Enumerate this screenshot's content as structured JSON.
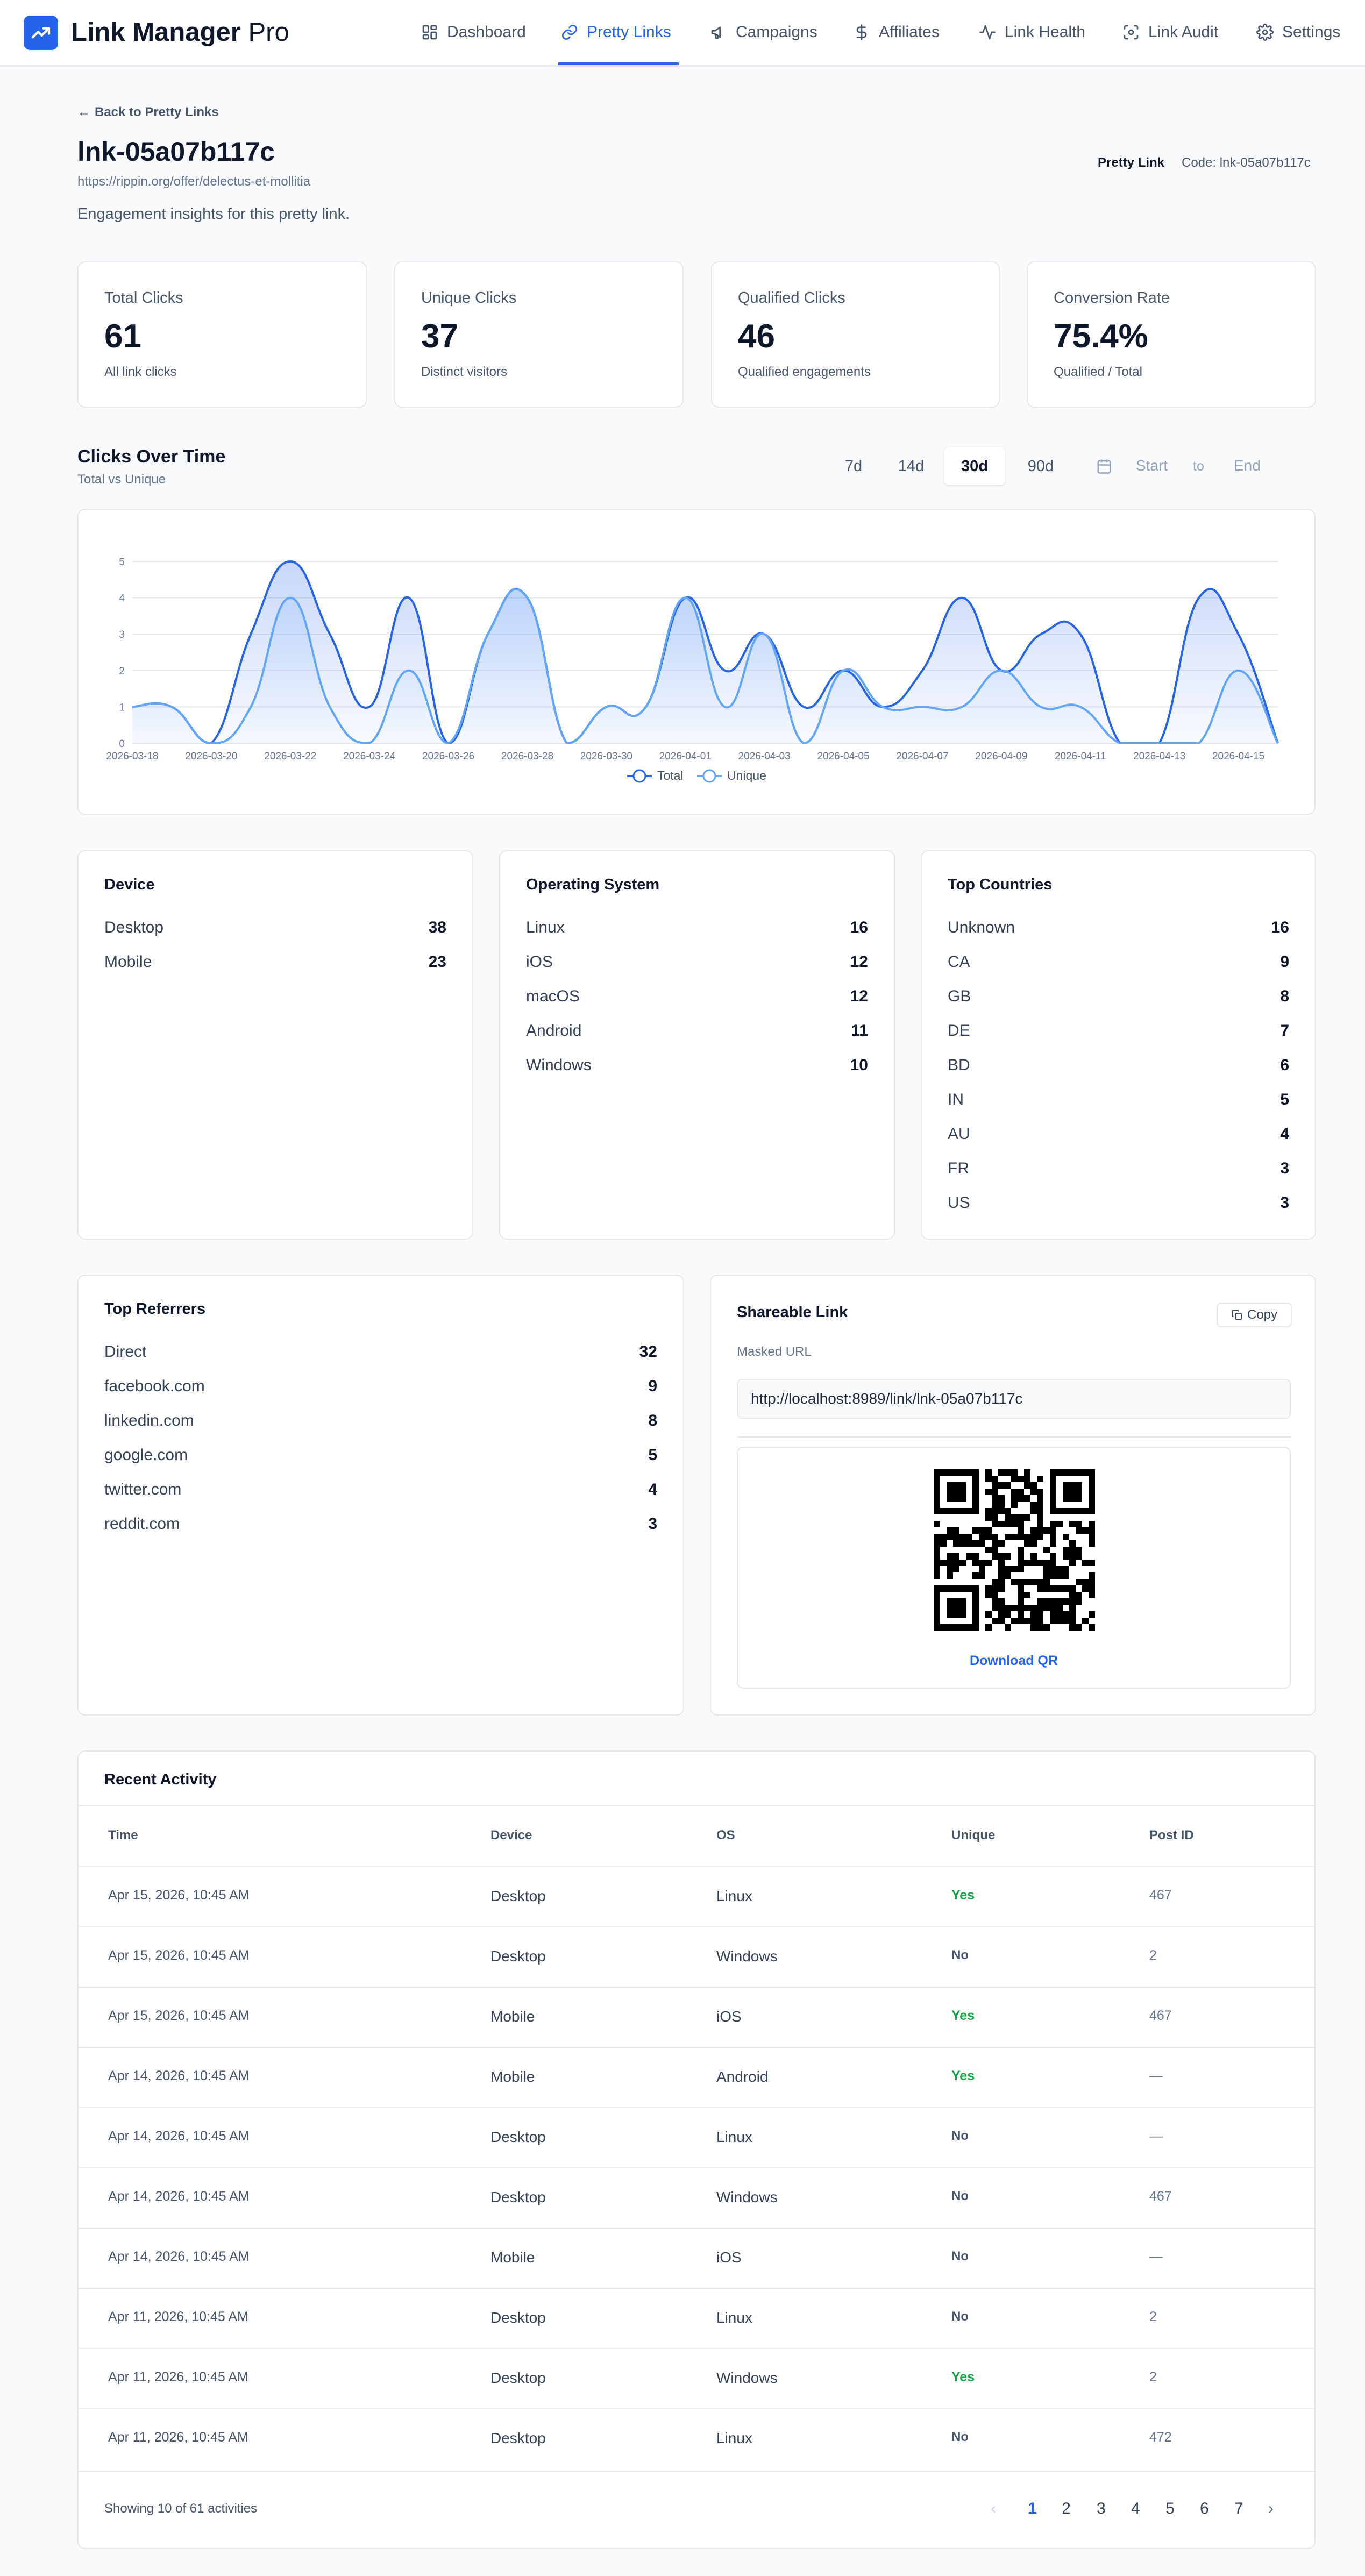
{
  "app": {
    "brand_bold": "Link Manager",
    "brand_light": " Pro"
  },
  "nav": [
    {
      "label": "Dashboard",
      "icon": "dashboard-icon"
    },
    {
      "label": "Pretty Links",
      "icon": "link-icon",
      "active": true
    },
    {
      "label": "Campaigns",
      "icon": "megaphone-icon"
    },
    {
      "label": "Affiliates",
      "icon": "dollar-icon"
    },
    {
      "label": "Link Health",
      "icon": "activity-icon"
    },
    {
      "label": "Link Audit",
      "icon": "scan-icon"
    },
    {
      "label": "Settings",
      "icon": "gear-icon"
    }
  ],
  "page": {
    "back": "Back to Pretty Links",
    "title": "lnk-05a07b117c",
    "url": "https://rippin.org/offer/delectus-et-mollitia",
    "subtitle": "Engagement insights for this pretty link.",
    "badge_type": "Pretty Link",
    "badge_code": "Code: lnk-05a07b117c"
  },
  "stats": [
    {
      "label": "Total Clicks",
      "value": "61",
      "sub": "All link clicks"
    },
    {
      "label": "Unique Clicks",
      "value": "37",
      "sub": "Distinct visitors"
    },
    {
      "label": "Qualified Clicks",
      "value": "46",
      "sub": "Qualified engagements"
    },
    {
      "label": "Conversion Rate",
      "value": "75.4%",
      "sub": "Qualified / Total"
    }
  ],
  "clicks_section": {
    "title": "Clicks Over Time",
    "subtitle": "Total vs Unique",
    "ranges": [
      "7d",
      "14d",
      "30d",
      "90d"
    ],
    "active_range": "30d",
    "start_placeholder": "Start",
    "to": "to",
    "end_placeholder": "End"
  },
  "chart_data": {
    "type": "area",
    "x": [
      "2026-03-18",
      "2026-03-19",
      "2026-03-20",
      "2026-03-21",
      "2026-03-22",
      "2026-03-23",
      "2026-03-24",
      "2026-03-25",
      "2026-03-26",
      "2026-03-27",
      "2026-03-28",
      "2026-03-29",
      "2026-03-30",
      "2026-03-31",
      "2026-04-01",
      "2026-04-02",
      "2026-04-03",
      "2026-04-04",
      "2026-04-05",
      "2026-04-06",
      "2026-04-07",
      "2026-04-08",
      "2026-04-09",
      "2026-04-10",
      "2026-04-11",
      "2026-04-12",
      "2026-04-13",
      "2026-04-14",
      "2026-04-15",
      "2026-04-16"
    ],
    "tick_labels": [
      "2026-03-18",
      "2026-03-20",
      "2026-03-22",
      "2026-03-24",
      "2026-03-26",
      "2026-03-28",
      "2026-03-30",
      "2026-04-01",
      "2026-04-03",
      "2026-04-05",
      "2026-04-07",
      "2026-04-09",
      "2026-04-11",
      "2026-04-13",
      "2026-04-15"
    ],
    "series": [
      {
        "name": "Total",
        "color": "#2563eb",
        "values": [
          1,
          1,
          0,
          3,
          5,
          3,
          1,
          4,
          0,
          3,
          4,
          0,
          1,
          1,
          4,
          2,
          3,
          1,
          2,
          1,
          2,
          4,
          2,
          3,
          3,
          0,
          0,
          4,
          3,
          0
        ]
      },
      {
        "name": "Unique",
        "color": "#60a5fa",
        "values": [
          1,
          1,
          0,
          1,
          4,
          1,
          0,
          2,
          0,
          3,
          4,
          0,
          1,
          1,
          4,
          1,
          3,
          0,
          2,
          1,
          1,
          1,
          2,
          1,
          1,
          0,
          0,
          0,
          2,
          0
        ]
      }
    ],
    "ylim": [
      0,
      5
    ],
    "yticks": [
      0,
      1,
      2,
      3,
      4,
      5
    ],
    "grid": true,
    "legend": "bottom-center",
    "xlabel": "",
    "ylabel": ""
  },
  "device": {
    "title": "Device",
    "rows": [
      {
        "label": "Desktop",
        "value": "38"
      },
      {
        "label": "Mobile",
        "value": "23"
      }
    ]
  },
  "os": {
    "title": "Operating System",
    "rows": [
      {
        "label": "Linux",
        "value": "16"
      },
      {
        "label": "iOS",
        "value": "12"
      },
      {
        "label": "macOS",
        "value": "12"
      },
      {
        "label": "Android",
        "value": "11"
      },
      {
        "label": "Windows",
        "value": "10"
      }
    ]
  },
  "countries": {
    "title": "Top Countries",
    "rows": [
      {
        "label": "Unknown",
        "value": "16"
      },
      {
        "label": "CA",
        "value": "9"
      },
      {
        "label": "GB",
        "value": "8"
      },
      {
        "label": "DE",
        "value": "7"
      },
      {
        "label": "BD",
        "value": "6"
      },
      {
        "label": "IN",
        "value": "5"
      },
      {
        "label": "AU",
        "value": "4"
      },
      {
        "label": "FR",
        "value": "3"
      },
      {
        "label": "US",
        "value": "3"
      }
    ]
  },
  "referrers": {
    "title": "Top Referrers",
    "rows": [
      {
        "label": "Direct",
        "value": "32"
      },
      {
        "label": "facebook.com",
        "value": "9"
      },
      {
        "label": "linkedin.com",
        "value": "8"
      },
      {
        "label": "google.com",
        "value": "5"
      },
      {
        "label": "twitter.com",
        "value": "4"
      },
      {
        "label": "reddit.com",
        "value": "3"
      }
    ]
  },
  "share": {
    "title": "Shareable Link",
    "copy": "Copy",
    "masked_label": "Masked URL",
    "masked_url": "http://localhost:8989/link/lnk-05a07b117c",
    "download": "Download QR"
  },
  "activity": {
    "title": "Recent Activity",
    "columns": [
      "Time",
      "Device",
      "OS",
      "Unique",
      "Post ID"
    ],
    "rows": [
      {
        "time": "Apr 15, 2026, 10:45 AM",
        "device": "Desktop",
        "os": "Linux",
        "unique": "Yes",
        "post": "467"
      },
      {
        "time": "Apr 15, 2026, 10:45 AM",
        "device": "Desktop",
        "os": "Windows",
        "unique": "No",
        "post": "2"
      },
      {
        "time": "Apr 15, 2026, 10:45 AM",
        "device": "Mobile",
        "os": "iOS",
        "unique": "Yes",
        "post": "467"
      },
      {
        "time": "Apr 14, 2026, 10:45 AM",
        "device": "Mobile",
        "os": "Android",
        "unique": "Yes",
        "post": "—"
      },
      {
        "time": "Apr 14, 2026, 10:45 AM",
        "device": "Desktop",
        "os": "Linux",
        "unique": "No",
        "post": "—"
      },
      {
        "time": "Apr 14, 2026, 10:45 AM",
        "device": "Desktop",
        "os": "Windows",
        "unique": "No",
        "post": "467"
      },
      {
        "time": "Apr 14, 2026, 10:45 AM",
        "device": "Mobile",
        "os": "iOS",
        "unique": "No",
        "post": "—"
      },
      {
        "time": "Apr 11, 2026, 10:45 AM",
        "device": "Desktop",
        "os": "Linux",
        "unique": "No",
        "post": "2"
      },
      {
        "time": "Apr 11, 2026, 10:45 AM",
        "device": "Desktop",
        "os": "Windows",
        "unique": "Yes",
        "post": "2"
      },
      {
        "time": "Apr 11, 2026, 10:45 AM",
        "device": "Desktop",
        "os": "Linux",
        "unique": "No",
        "post": "472"
      }
    ],
    "footer": "Showing 10 of 61 activities",
    "pages": [
      "1",
      "2",
      "3",
      "4",
      "5",
      "6",
      "7"
    ],
    "current_page": "1"
  }
}
